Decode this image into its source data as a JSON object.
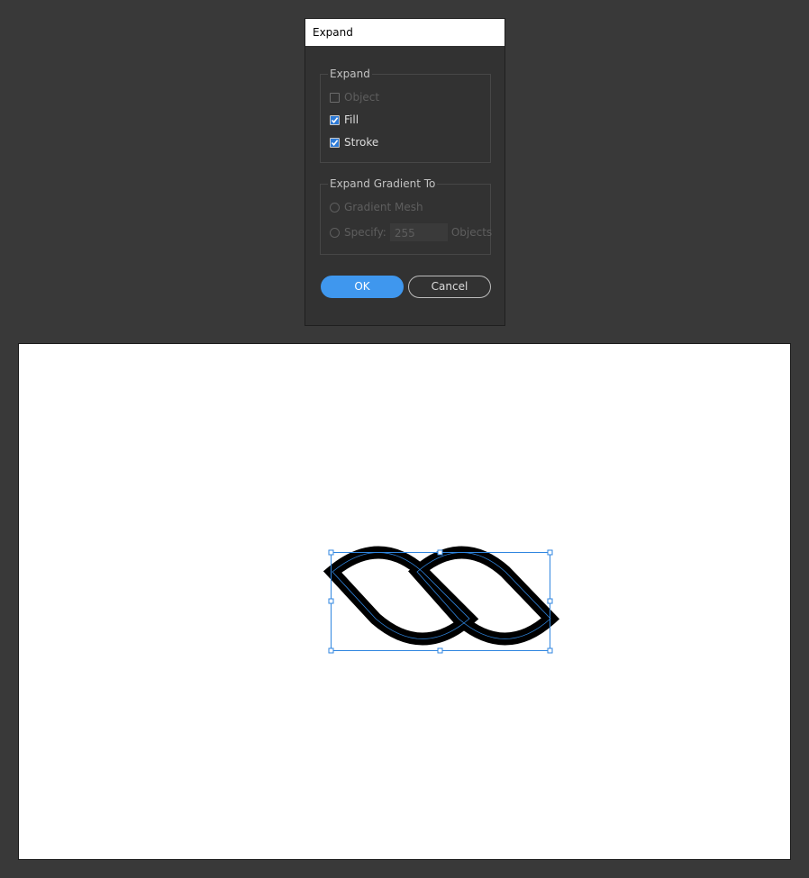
{
  "dialog": {
    "title": "Expand",
    "expand_group": {
      "title": "Expand",
      "options": [
        {
          "label": "Object",
          "checked": false,
          "enabled": false
        },
        {
          "label": "Fill",
          "checked": true,
          "enabled": true
        },
        {
          "label": "Stroke",
          "checked": true,
          "enabled": true
        }
      ]
    },
    "gradient_group": {
      "title": "Expand Gradient To",
      "gradient_mesh_label": "Gradient Mesh",
      "specify_label": "Specify:",
      "specify_value": "255",
      "objects_label": "Objects"
    },
    "ok_label": "OK",
    "cancel_label": "Cancel"
  },
  "colors": {
    "accent": "#3f97ee",
    "selection": "#2f86e0",
    "stroke": "#000000"
  }
}
